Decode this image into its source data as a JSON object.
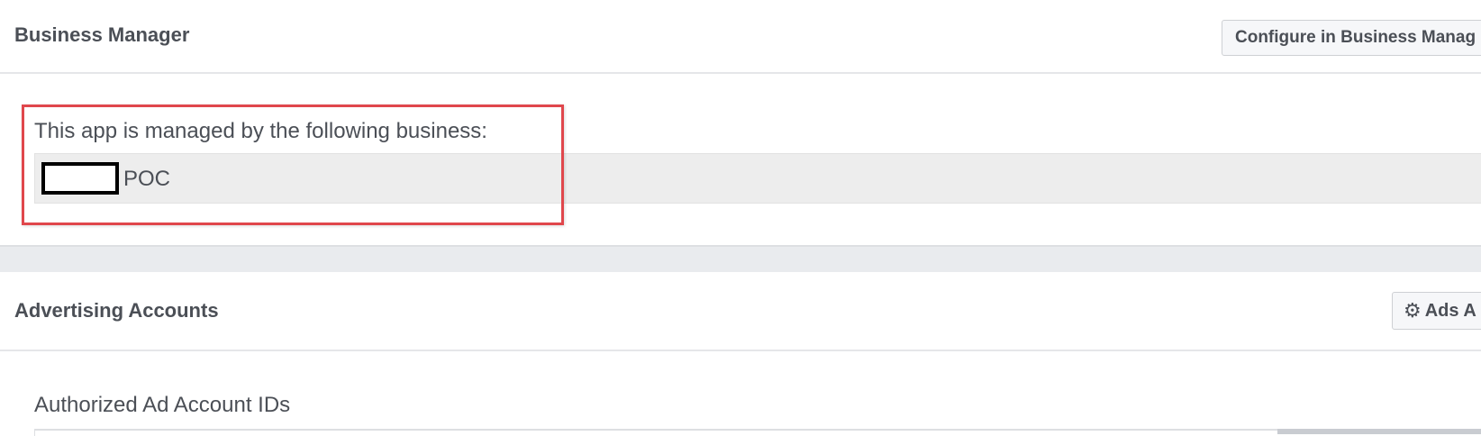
{
  "business_manager": {
    "title": "Business Manager",
    "configure_button": "Configure in Business Manag",
    "managed_text": "This app is managed by the following business:",
    "business_name": "POC",
    "highlight_color": "#e0474c"
  },
  "advertising_accounts": {
    "title": "Advertising Accounts",
    "settings_button": "Ads A",
    "settings_icon": "gear-icon",
    "authorized_label": "Authorized Ad Account IDs"
  }
}
